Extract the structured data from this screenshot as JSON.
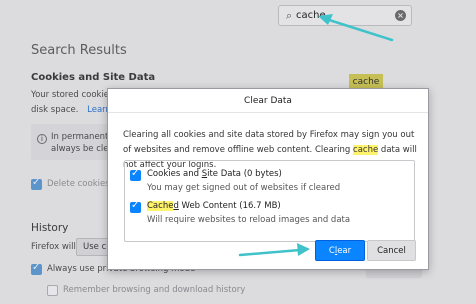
{
  "search": {
    "value": "cache"
  },
  "background": {
    "results_heading": "Search Results",
    "cookies_heading": "Cookies and Site Data",
    "badge": "cache",
    "cookies_line1": "Your stored cookies,",
    "cookies_line2": "disk space.",
    "learn_more": "Learn m",
    "info_line1": "In permanent p",
    "info_line2": "always be clea",
    "delete_cookies": "Delete cookies a",
    "history_heading": "History",
    "firefox_will": "Firefox will",
    "use_custom": "Use cu",
    "always_use": "Always use private browsing mode",
    "remember": "Remember browsing and download history"
  },
  "dialog": {
    "title": "Clear Data",
    "desc_part1": "Clearing all cookies and site data stored by Firefox may sign you out of websites and remove offline web content. Clearing ",
    "desc_highlight": "cache",
    "desc_part2": " data will not affect your logins.",
    "options": [
      {
        "label_pre": "Cookies and ",
        "label_u": "S",
        "label_post": "ite Data (0 bytes)",
        "desc": "You may get signed out of websites if cleared",
        "checked": true
      },
      {
        "label_hl": "Cache",
        "label_u": "d",
        "label_post": " Web Content (16.7 MB)",
        "desc": "Will require websites to reload images and data",
        "checked": true
      }
    ],
    "clear_pre": "C",
    "clear_u": "l",
    "clear_post": "ear",
    "cancel_label": "Cancel"
  },
  "colors": {
    "accent": "#0a84ff",
    "highlight": "#fff36b",
    "arrow": "#3fc2c9"
  }
}
